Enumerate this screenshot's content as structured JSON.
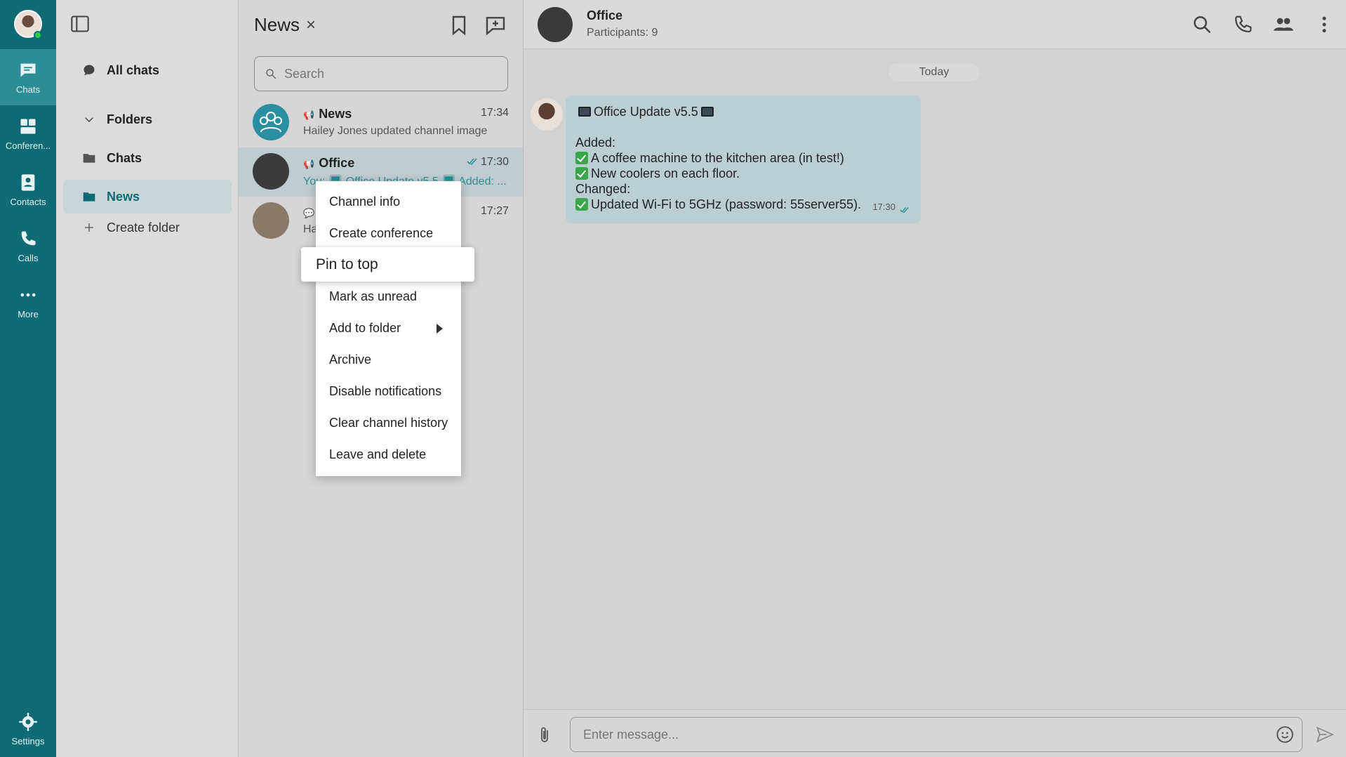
{
  "rail": {
    "items": [
      {
        "label": "Chats",
        "icon": "chat-bubble-icon"
      },
      {
        "label": "Conferen...",
        "icon": "conference-icon"
      },
      {
        "label": "Contacts",
        "icon": "contacts-icon"
      },
      {
        "label": "Calls",
        "icon": "calls-icon"
      },
      {
        "label": "More",
        "icon": "more-dots-icon"
      }
    ],
    "settings_label": "Settings"
  },
  "folders": {
    "all_chats": "All chats",
    "folders_header": "Folders",
    "items": [
      {
        "label": "Chats"
      },
      {
        "label": "News"
      }
    ],
    "create_label": "Create folder"
  },
  "chatlist": {
    "title": "News",
    "close_glyph": "×",
    "search_placeholder": "Search",
    "rows": [
      {
        "name": "News",
        "time": "17:34",
        "message": "Hailey Jones updated channel image"
      },
      {
        "name": "Office",
        "time": "17:30",
        "message": "You: 🖥 Office Update v5.5 🖥 Added: ..."
      },
      {
        "name": "",
        "time": "17:27",
        "message": "Ha...                                              l to gro..."
      }
    ]
  },
  "context_menu": {
    "items": [
      "Channel info",
      "Create conference",
      "Pin to top",
      "Mark as unread",
      "Add to folder",
      "Archive",
      "Disable notifications",
      "Clear channel history",
      "Leave and delete"
    ]
  },
  "conversation": {
    "title": "Office",
    "subtitle": "Participants: 9",
    "date_pill": "Today",
    "message": {
      "heading": "Office Update v5.5",
      "added_label": "Added:",
      "line1": "A coffee machine to the kitchen area (in test!)",
      "line2": "New coolers on each floor.",
      "changed_label": "Changed:",
      "line3": "Updated Wi-Fi to 5GHz (password: 55server55).",
      "time": "17:30"
    },
    "composer_placeholder": "Enter message..."
  },
  "colors": {
    "rail": "#0e6b75",
    "rail_active": "#2d8d96",
    "accent": "#0e6b75",
    "bubble": "#b9cfd1"
  }
}
